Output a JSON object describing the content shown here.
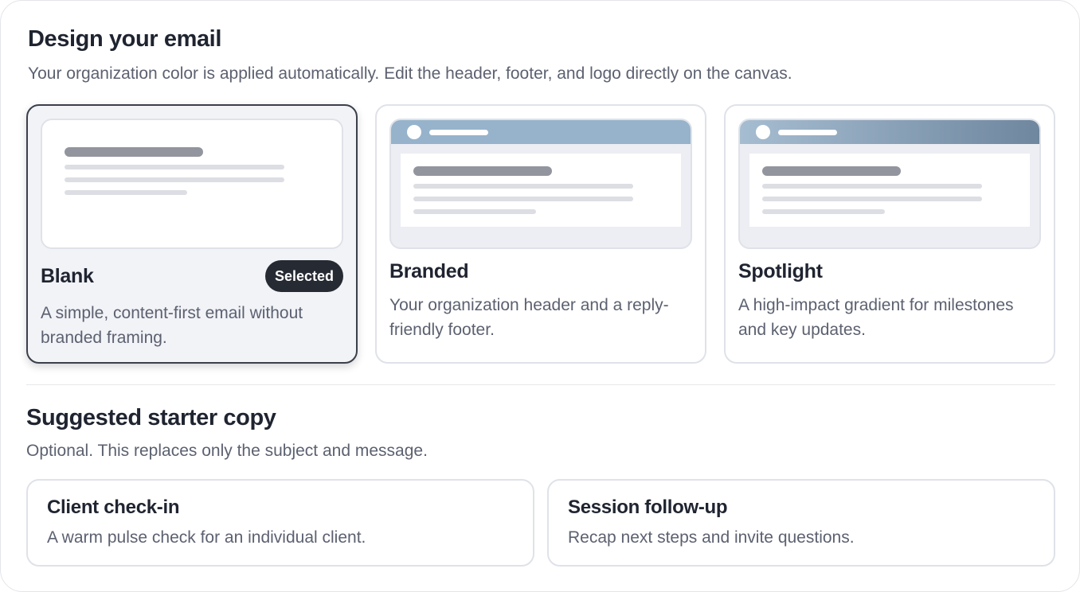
{
  "design": {
    "title": "Design your email",
    "subtitle": "Your organization color is applied automatically. Edit the header, footer, and logo directly on the canvas.",
    "templates": [
      {
        "name": "Blank",
        "description": "A simple, content-first email without branded framing.",
        "selected": true,
        "badge": "Selected"
      },
      {
        "name": "Branded",
        "description": "Your organization header and a reply-friendly footer.",
        "selected": false,
        "header_color": "#96b3cb"
      },
      {
        "name": "Spotlight",
        "description": "A high-impact gradient for milestones and key updates.",
        "selected": false,
        "header_gradient": [
          "#a6bdd1",
          "#6f879f"
        ]
      }
    ]
  },
  "starter_copy": {
    "title": "Suggested starter copy",
    "subtitle": "Optional. This replaces only the subject and message.",
    "options": [
      {
        "title": "Client check-in",
        "description": "A warm pulse check for an individual client."
      },
      {
        "title": "Session follow-up",
        "description": "Recap next steps and invite questions."
      }
    ]
  },
  "colors": {
    "selected_border": "#3b3f4a",
    "badge_bg": "#262a33",
    "heading": "#1f2430",
    "muted_text": "#5c6170"
  }
}
